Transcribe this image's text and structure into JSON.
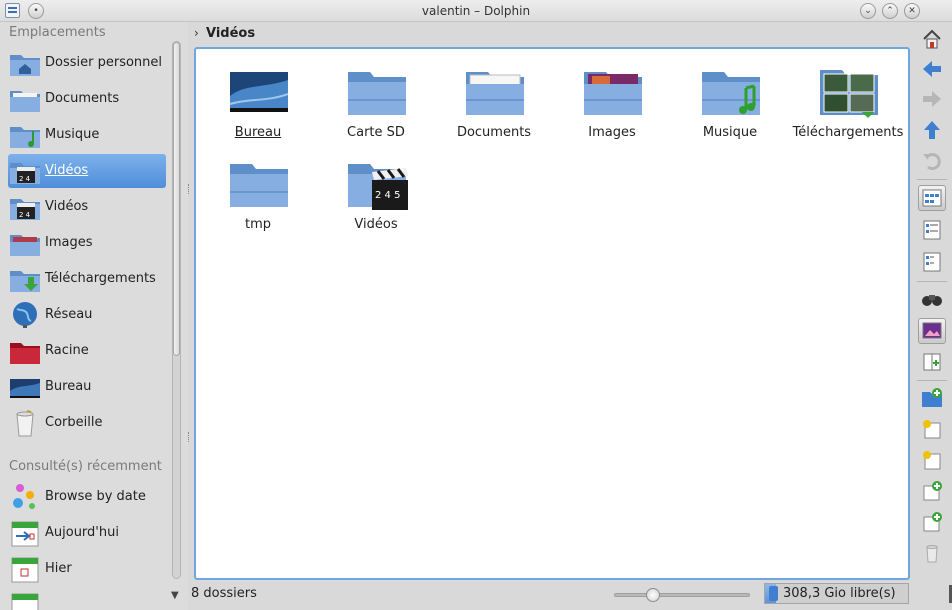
{
  "window": {
    "title": "valentin – Dolphin",
    "minimize_glyph": "⌄",
    "maximize_glyph": "⌃",
    "close_glyph": "✕",
    "menu_glyph": "•"
  },
  "sidebar": {
    "places_header": "Emplacements",
    "places": [
      {
        "label": "Dossier personnel",
        "icon": "home-folder-icon"
      },
      {
        "label": "Documents",
        "icon": "documents-folder-icon"
      },
      {
        "label": "Musique",
        "icon": "music-folder-icon"
      },
      {
        "label": "Vidéos",
        "icon": "videos-folder-icon",
        "selected": true
      },
      {
        "label": "Vidéos",
        "icon": "videos-folder-icon"
      },
      {
        "label": "Images",
        "icon": "images-folder-icon"
      },
      {
        "label": "Téléchargements",
        "icon": "downloads-folder-icon"
      },
      {
        "label": "Réseau",
        "icon": "network-globe-icon"
      },
      {
        "label": "Racine",
        "icon": "root-folder-icon"
      },
      {
        "label": "Bureau",
        "icon": "desktop-icon"
      },
      {
        "label": "Corbeille",
        "icon": "trash-icon"
      }
    ],
    "recent_header": "Consulté(s) récemment",
    "recent": [
      {
        "label": "Browse by date",
        "icon": "browse-date-icon"
      },
      {
        "label": "Aujourd'hui",
        "icon": "calendar-today-icon"
      },
      {
        "label": "Hier",
        "icon": "calendar-yesterday-icon"
      }
    ]
  },
  "breadcrumb": {
    "separator": "›",
    "current": "Vidéos"
  },
  "items": [
    {
      "name": "Bureau",
      "icon": "desktop-icon",
      "underlined": true
    },
    {
      "name": "Carte SD",
      "icon": "folder-icon"
    },
    {
      "name": "Documents",
      "icon": "documents-folder-icon"
    },
    {
      "name": "Images",
      "icon": "images-folder-icon"
    },
    {
      "name": "Musique",
      "icon": "music-folder-icon"
    },
    {
      "name": "Téléchargements",
      "icon": "downloads-folder-icon"
    },
    {
      "name": "tmp",
      "icon": "folder-icon"
    },
    {
      "name": "Vidéos",
      "icon": "videos-folder-icon"
    }
  ],
  "status": {
    "summary": "8 dossiers",
    "free_space": "308,3 Gio libre(s)",
    "disk_used_fraction": 0.08,
    "zoom_fraction": 0.25
  },
  "colors": {
    "accent": "#4f8fd9",
    "folder": "#7fa9dc",
    "view_border": "#6fa6de"
  }
}
